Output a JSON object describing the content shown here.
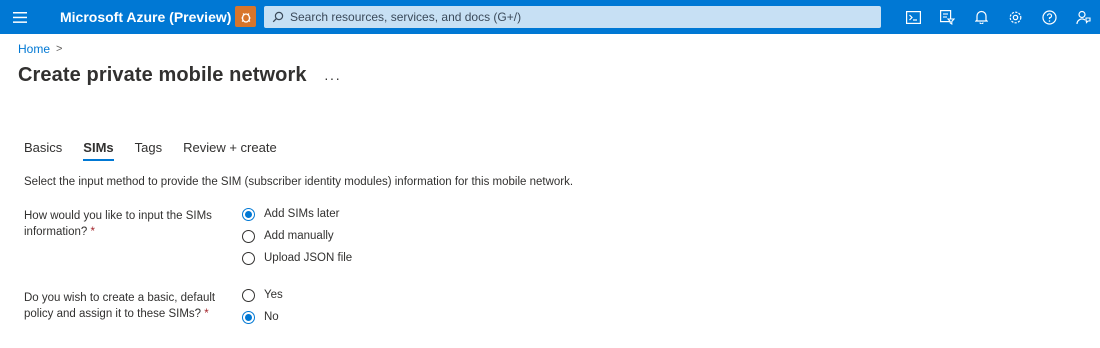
{
  "topbar": {
    "brand": "Microsoft Azure (Preview)",
    "search_placeholder": "Search resources, services, and docs (G+/)",
    "icons": [
      "cloud-shell-icon",
      "directory-filter-icon",
      "notifications-icon",
      "settings-icon",
      "help-icon",
      "feedback-icon"
    ],
    "accent_color": "#0078d4"
  },
  "breadcrumb": {
    "home": "Home",
    "separator": ">"
  },
  "page": {
    "title": "Create private mobile network",
    "more": "···"
  },
  "tabs": [
    {
      "label": "Basics"
    },
    {
      "label": "SIMs"
    },
    {
      "label": "Tags"
    },
    {
      "label": "Review + create"
    }
  ],
  "active_tab": "SIMs",
  "intro": "Select the input method to provide the SIM (subscriber identity modules) information for this mobile network.",
  "questions": {
    "sims_input": {
      "label_line1": "How would you like to input the SIMs",
      "label_line2": "information?",
      "required_mark": "*",
      "options": [
        "Add SIMs later",
        "Add manually",
        "Upload JSON file"
      ],
      "selected": "Add SIMs later"
    },
    "default_policy": {
      "label_line1": "Do you wish to create a basic, default",
      "label_line2": "policy and assign it to these SIMs?",
      "required_mark": "*",
      "options": [
        "Yes",
        "No"
      ],
      "selected": "No"
    }
  }
}
